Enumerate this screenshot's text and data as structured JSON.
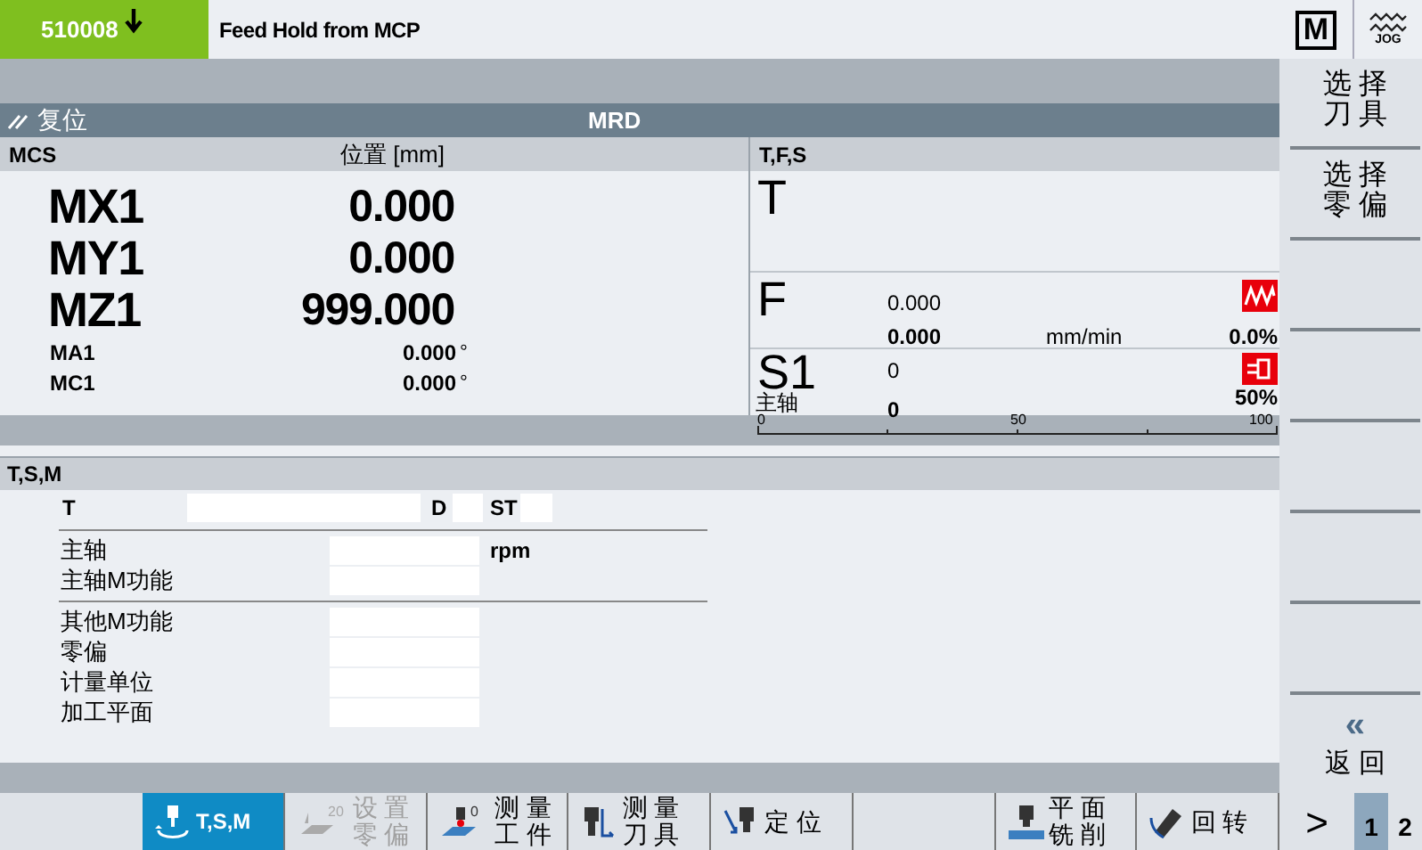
{
  "header": {
    "alarm_number": "510008",
    "alarm_message": "Feed Hold from MCP",
    "mode_label": "M",
    "jog_label": "JOG"
  },
  "channel": {
    "state": "复位",
    "program": "MRD"
  },
  "position": {
    "title": "MCS",
    "column": "位置 [mm]",
    "axes": [
      {
        "name": "MX1",
        "value": "0.000",
        "kind": "large"
      },
      {
        "name": "MY1",
        "value": "0.000",
        "kind": "large"
      },
      {
        "name": "MZ1",
        "value": "999.000",
        "kind": "large"
      },
      {
        "name": "MA1",
        "value": "0.000",
        "unit": "°",
        "kind": "small"
      },
      {
        "name": "MC1",
        "value": "0.000",
        "unit": "°",
        "kind": "small"
      }
    ]
  },
  "tfs": {
    "title": "T,F,S",
    "tool": {
      "label": "T"
    },
    "feed": {
      "label": "F",
      "value": "0.000",
      "actual": "0.000",
      "unit": "mm/min",
      "override": "0.0%"
    },
    "spindle": {
      "label": "S1",
      "sublabel": "主轴",
      "value": "0",
      "actual": "0",
      "override": "50%",
      "ticks": [
        "0",
        "50",
        "100"
      ]
    }
  },
  "tsm": {
    "title": "T,S,M",
    "tool_label": "T",
    "d_label": "D",
    "st_label": "ST",
    "groups": [
      [
        {
          "label": "主轴",
          "unit": "rpm"
        },
        {
          "label": "主轴M功能"
        }
      ],
      [
        {
          "label": "其他M功能"
        },
        {
          "label": "零偏"
        },
        {
          "label": "计量单位"
        },
        {
          "label": "加工平面"
        }
      ]
    ]
  },
  "side_softkeys": [
    {
      "kind": "text",
      "lines": [
        "选 择",
        "刀 具"
      ]
    },
    {
      "kind": "text",
      "lines": [
        "选 择",
        "零 偏"
      ]
    },
    {
      "kind": "empty"
    },
    {
      "kind": "empty"
    },
    {
      "kind": "empty"
    },
    {
      "kind": "empty"
    },
    {
      "kind": "empty"
    },
    {
      "kind": "back",
      "symbol": "«",
      "lines": [
        "返 回"
      ]
    }
  ],
  "bottom_softkeys": [
    {
      "kind": "tsm",
      "lines": [
        "T,S,M"
      ],
      "selected": true,
      "disabled": false
    },
    {
      "kind": "zero",
      "icon_text": "20",
      "lines": [
        "设 置",
        "零 偏"
      ],
      "selected": false,
      "disabled": true
    },
    {
      "kind": "measure-workpiece",
      "icon_text": "0",
      "lines": [
        "测 量",
        "工 件"
      ],
      "selected": false,
      "disabled": false
    },
    {
      "kind": "measure-tool",
      "lines": [
        "测 量",
        "刀 具"
      ],
      "selected": false,
      "disabled": false
    },
    {
      "kind": "position",
      "lines": [
        "定 位"
      ],
      "selected": false,
      "disabled": false
    },
    {
      "kind": "empty"
    },
    {
      "kind": "face-mill",
      "lines": [
        "平 面",
        "铣 削"
      ],
      "selected": false,
      "disabled": false
    },
    {
      "kind": "swivel",
      "lines": [
        "回 转"
      ],
      "selected": false,
      "disabled": false
    }
  ],
  "pager": {
    "more": ">",
    "pages": [
      {
        "label": "1",
        "selected": true
      },
      {
        "label": "2",
        "selected": false
      }
    ]
  }
}
